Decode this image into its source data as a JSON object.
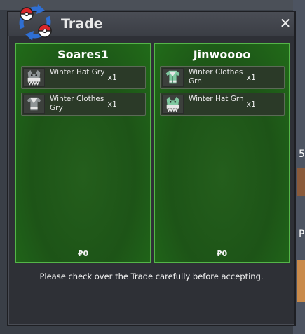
{
  "window": {
    "title": "Trade",
    "close_symbol": "✕"
  },
  "left_party": {
    "name": "Soares1",
    "items": [
      {
        "name": "Winter Hat Gry",
        "qty": "x1",
        "icon": "winter-hat-grey-icon"
      },
      {
        "name": "Winter Clothes Gry",
        "qty": "x1",
        "icon": "winter-clothes-grey-icon"
      }
    ],
    "money": "₽0"
  },
  "right_party": {
    "name": "Jinwoooo",
    "items": [
      {
        "name": "Winter Clothes Grn",
        "qty": "x1",
        "icon": "winter-clothes-green-icon"
      },
      {
        "name": "Winter Hat Grn",
        "qty": "x1",
        "icon": "winter-hat-green-icon"
      }
    ],
    "money": "₽0"
  },
  "notice": "Please check over the Trade carefully before accepting.",
  "background": {
    "edge_text_1": "5",
    "edge_text_2": "P"
  },
  "colors": {
    "panel_green": "#1d5417",
    "panel_border": "#54b548",
    "window_bg": "#2e3036"
  }
}
